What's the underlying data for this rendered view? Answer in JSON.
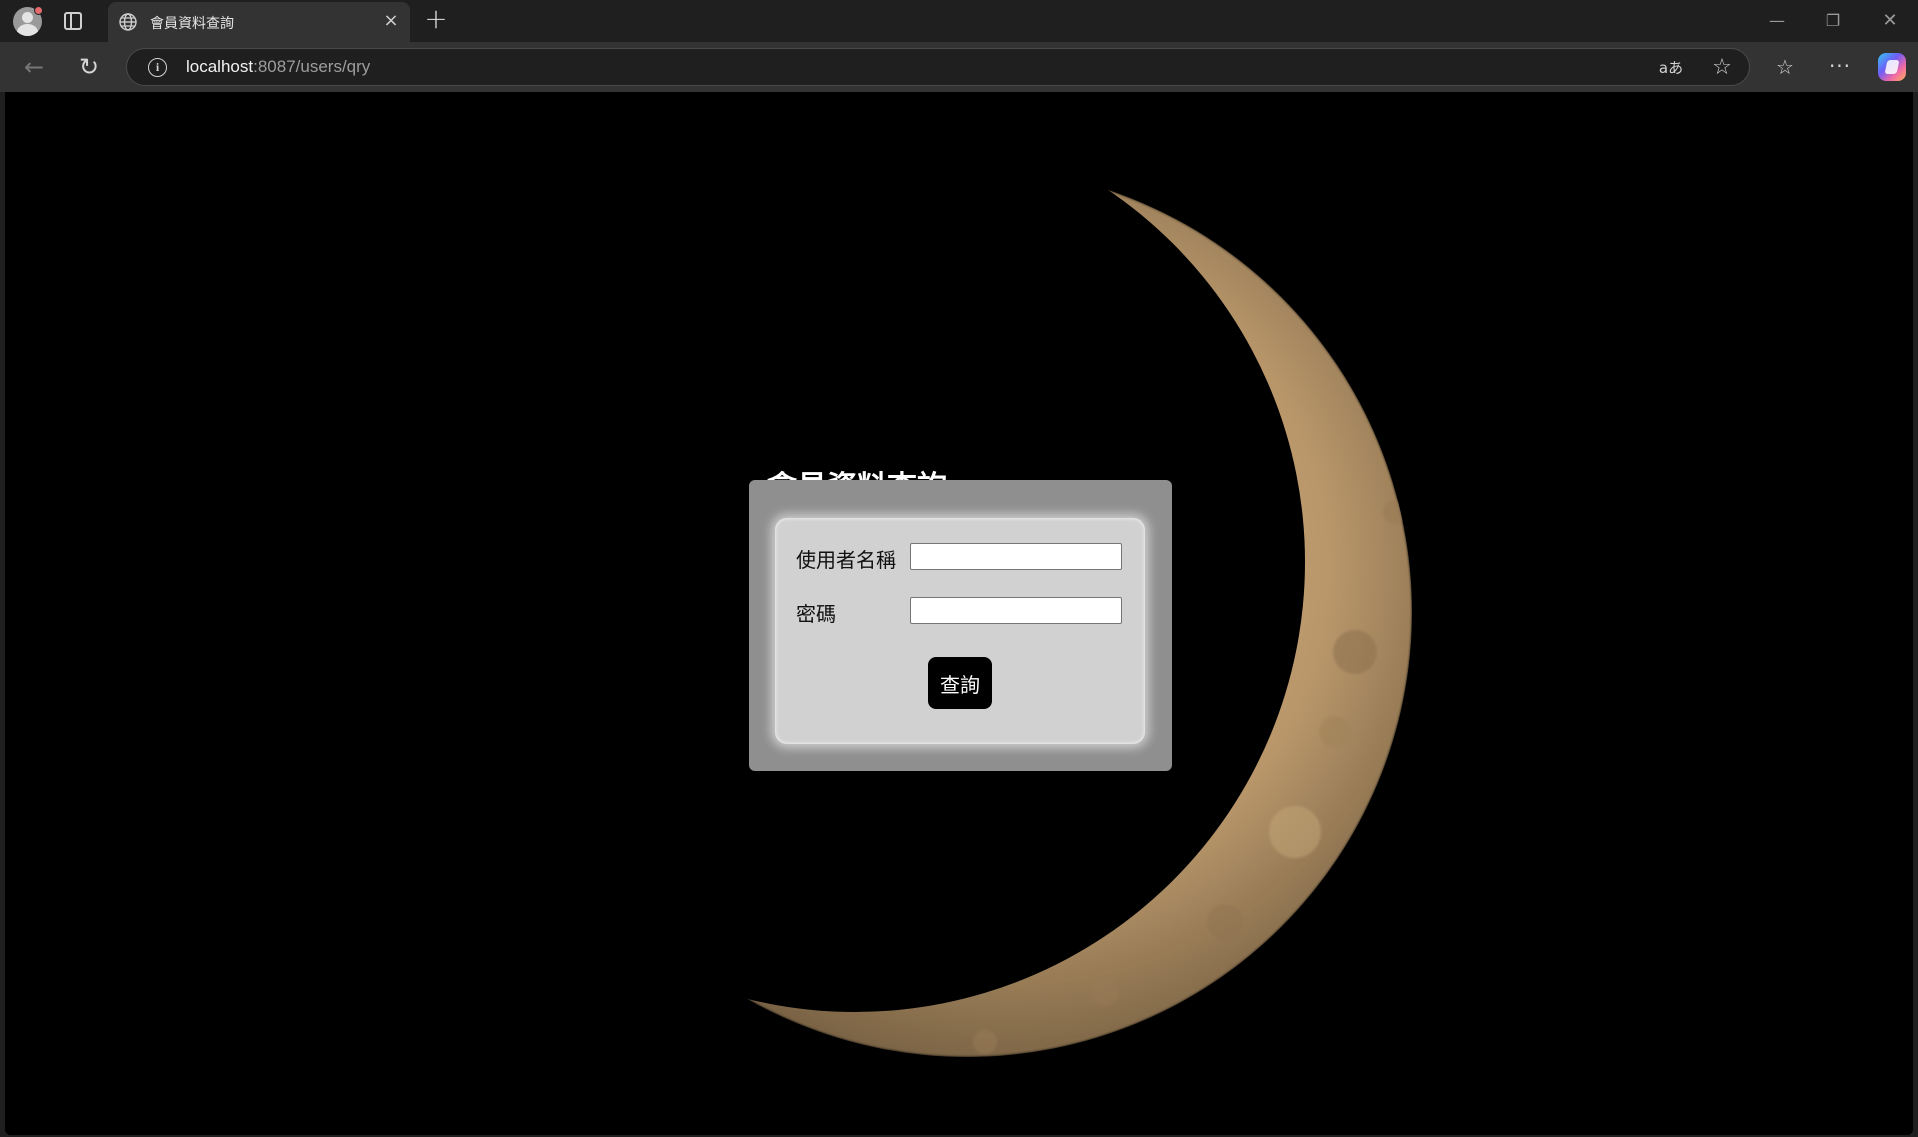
{
  "tab": {
    "title": "會員資料查詢",
    "close_label": "×"
  },
  "toolbar": {
    "url_host": "localhost",
    "url_rest": ":8087/users/qry",
    "read_aloud_label": "aあ"
  },
  "form": {
    "title": "會員資料查詢",
    "username_label": "使用者名稱",
    "username_value": "",
    "password_label": "密碼",
    "password_value": "",
    "submit_label": "查詢"
  },
  "colors": {
    "page_background": "#000000",
    "outer_box": "#8f8f8f",
    "inner_box": "#d1d1d1",
    "button": "#000000"
  }
}
